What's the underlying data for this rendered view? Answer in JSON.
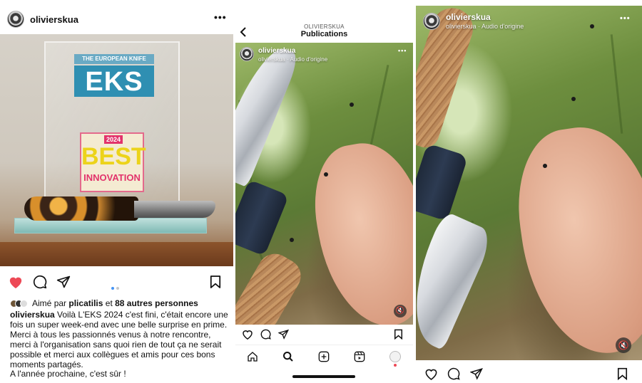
{
  "panel1": {
    "username": "olivierskua",
    "more_icon": "more-horizontal-icon",
    "photo": {
      "trophy_header": "THE EUROPEAN KNIFE SHOW",
      "trophy_logo": "EKS",
      "award_year": "2024",
      "award_title": "BEST",
      "award_subtitle": "INNOVATION"
    },
    "liked_prefix": "Aimé par",
    "liked_user": "plicatilis",
    "liked_mid": "et",
    "liked_count": "88 autres personnes",
    "caption_user": "olivierskua",
    "caption_text": " Voilà L'EKS 2024 c'est fini, c'était encore une fois un super week-end avec une belle surprise en prime. Merci à tous les passionnés venus à notre rencontre, merci à l'organisation sans quoi rien de tout ça ne serait possible et merci aux collègues et amis pour ces bons moments partagés.",
    "caption_last": "A l'année prochaine, c'est sûr !",
    "carousel": {
      "count": 2,
      "active": 0
    },
    "accent_like": "#ed4956",
    "dot_active": "#4595f4"
  },
  "panel2": {
    "header_sub": "OLIVIERSKUA",
    "header_title": "Publications",
    "username": "olivierskua",
    "subtitle": "olivierskua · Audio d'origine",
    "nav_icons": [
      "home-icon",
      "search-icon",
      "add-icon",
      "reels-icon",
      "profile-icon"
    ]
  },
  "panel3": {
    "username": "olivierskua",
    "subtitle": "olivierskua · Audio d'origine"
  }
}
